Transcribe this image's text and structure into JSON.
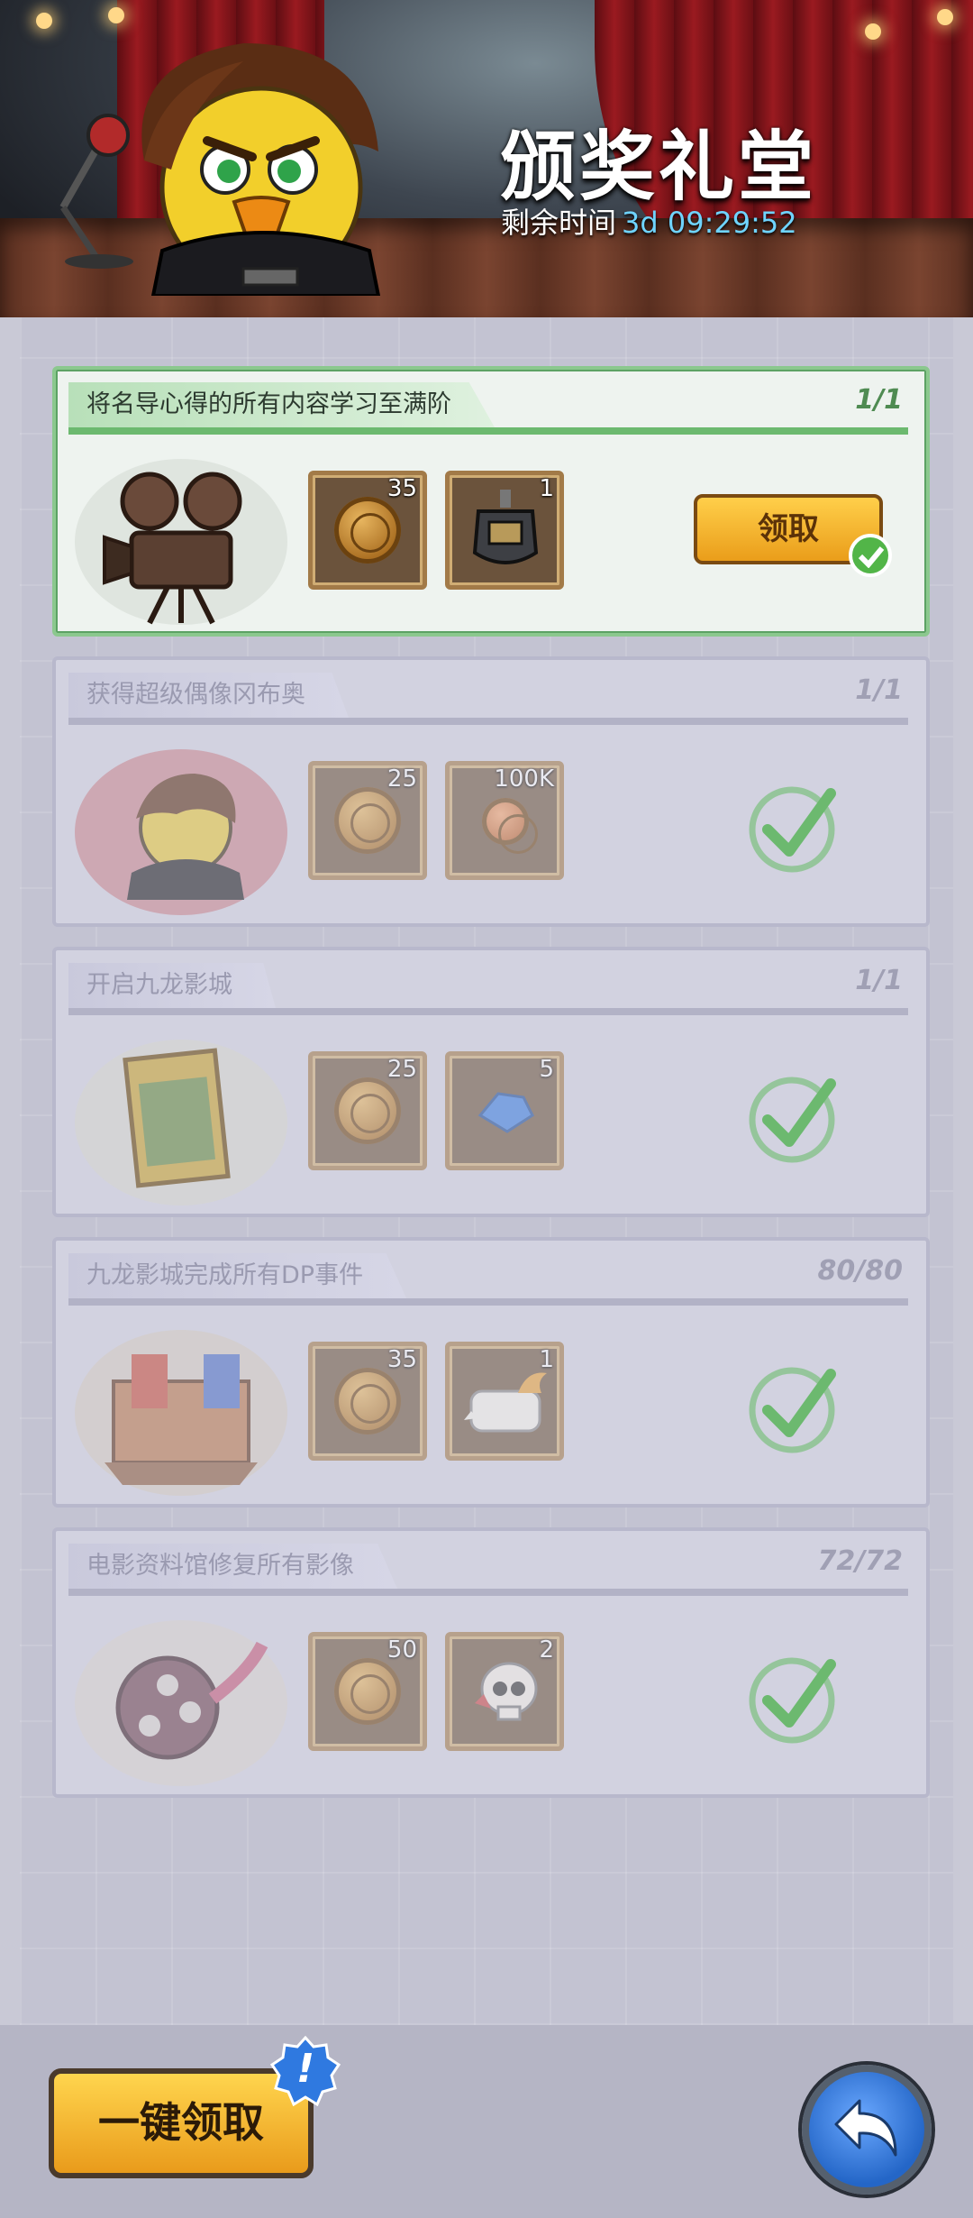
{
  "header": {
    "title": "颁奖礼堂",
    "timer_label": "剩余时间",
    "timer_value": "3d  09:29:52"
  },
  "tasks": [
    {
      "title": "将名导心得的所有内容学习至满阶",
      "progress": "1/1",
      "rewards": [
        {
          "icon": "dragon-coin-icon",
          "count": "35"
        },
        {
          "icon": "director-badge-icon",
          "count": "1"
        }
      ],
      "state": "claimable",
      "button_label": "领取"
    },
    {
      "title": "获得超级偶像冈布奥",
      "progress": "1/1",
      "rewards": [
        {
          "icon": "dragon-coin-icon",
          "count": "25"
        },
        {
          "icon": "copper-coin-icon",
          "count": "100K"
        }
      ],
      "state": "claimed"
    },
    {
      "title": "开启九龙影城",
      "progress": "1/1",
      "rewards": [
        {
          "icon": "dragon-coin-icon",
          "count": "25"
        },
        {
          "icon": "blue-crystal-icon",
          "count": "5"
        }
      ],
      "state": "claimed"
    },
    {
      "title": "九龙影城完成所有DP事件",
      "progress": "80/80",
      "rewards": [
        {
          "icon": "dragon-coin-icon",
          "count": "35"
        },
        {
          "icon": "speech-bubble-icon",
          "count": "1"
        }
      ],
      "state": "claimed"
    },
    {
      "title": "电影资料馆修复所有影像",
      "progress": "72/72",
      "rewards": [
        {
          "icon": "dragon-coin-icon",
          "count": "50"
        },
        {
          "icon": "skull-icon",
          "count": "2"
        }
      ],
      "state": "claimed"
    }
  ],
  "footer": {
    "claim_all_label": "一键领取",
    "alert_badge": "!"
  },
  "colors": {
    "accent_orange": "#f0a61f",
    "active_green": "#6cb96f",
    "timer_blue": "#6fd4ff",
    "check_green": "#52b548"
  }
}
